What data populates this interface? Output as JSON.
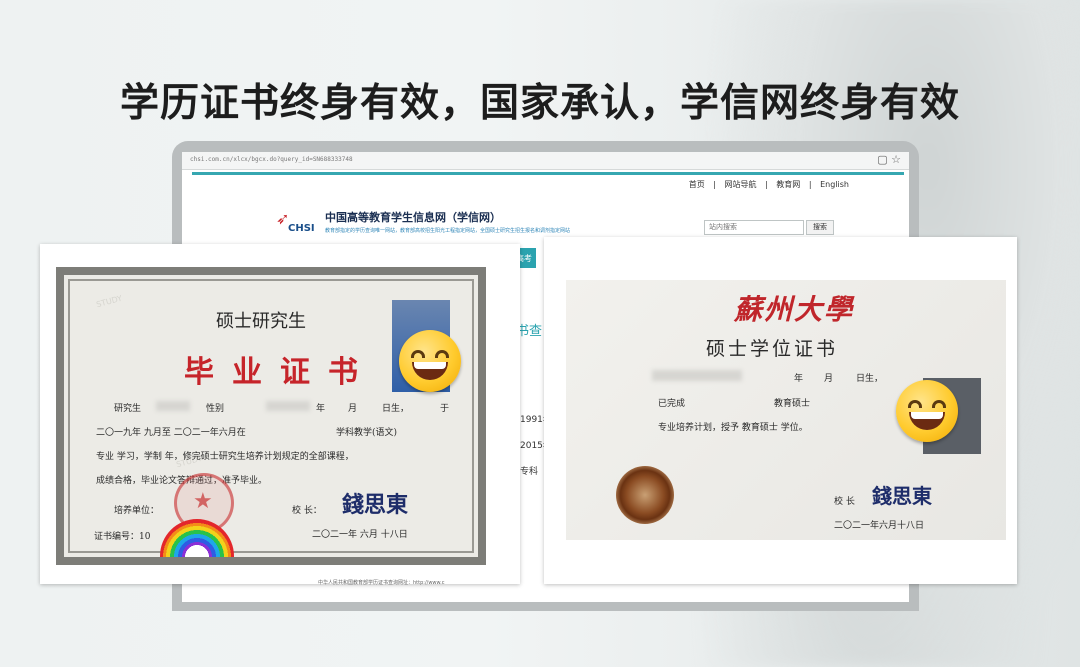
{
  "headline": "学历证书终身有效，国家承认，学信网终身有效",
  "browser": {
    "address": "chsi.com.cn/xlcx/bgcx.do?query_id=SN688333748",
    "topnav": [
      "首页",
      "|",
      "网站导航",
      "|",
      "教育网",
      "|",
      "English"
    ],
    "logo_text": "CHSI",
    "site_title": "中国高等教育学生信息网（学信网）",
    "site_subtitle": "教育部指定的学历查询唯一网站，教育部高校招生阳光工程指定网站，全国硕士研究生招生报名和调剂指定网站",
    "search_placeholder": "站内搜索",
    "search_button": "搜索",
    "fragments": [
      "高考",
      "书查",
      "1991年",
      "2015年",
      "专科"
    ]
  },
  "cert_left": {
    "title": "硕士研究生",
    "main": "毕业证书",
    "line1_label_student": "研究生",
    "line1_label_gender": "性别",
    "line1_year": "年",
    "line1_month": "月",
    "line1_birth": "日生，",
    "line1_end": "于",
    "line2": "二〇一九年  九月至  二〇二一年六月在",
    "line2_subject": "学科教学(语文)",
    "line3": "专业    学习，学制    年，修完硕士研究生培养计划规定的全部课程，",
    "line4": "成绩合格，毕业论文答辩通过，准予毕业。",
    "unit_label": "培养单位：",
    "president_label": "校    长：",
    "signature": "錢思東",
    "cert_no_label": "证书编号：10",
    "date": "二〇二一年    六月    十八日",
    "footer": "中华人民共和国教育部学历证书查询网址：http://www.c"
  },
  "cert_right": {
    "university": "蘇州大學",
    "title": "硕士学位证书",
    "line1_year": "年",
    "line1_month": "月",
    "line1_day": "日生，",
    "line2_a": "已完成",
    "line2_b": "教育硕士",
    "line3": "专业培养计划，授予  教育硕士  学位。",
    "president_label": "校  长",
    "signature": "錢思東",
    "date": "二〇二一年六月十八日"
  }
}
